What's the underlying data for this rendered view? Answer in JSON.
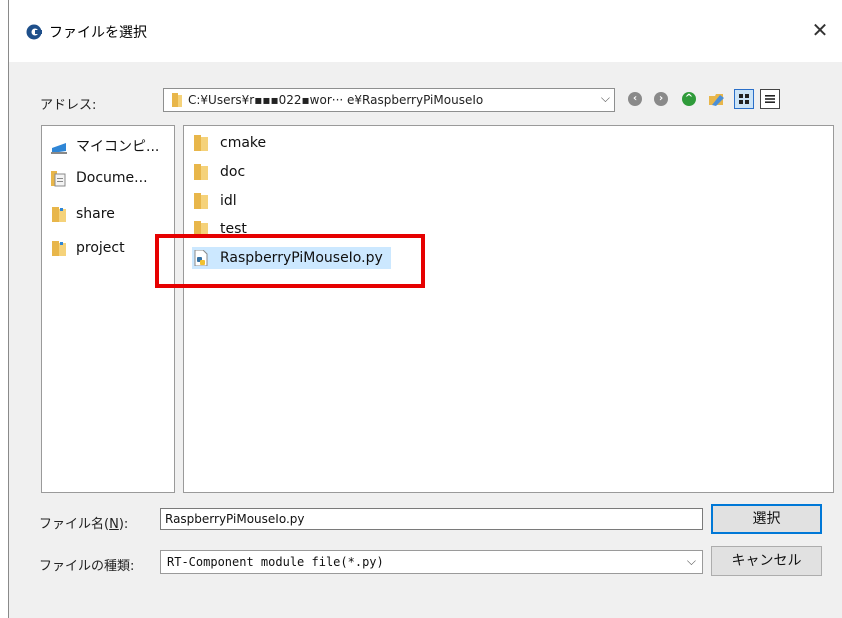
{
  "window": {
    "title": "ファイルを選択",
    "close_symbol": "✕"
  },
  "address": {
    "label": "アドレス:",
    "path": "C:¥Users¥r▪▪▪022▪wor··· e¥RaspberryPiMouseIo",
    "dropdown_symbol": "⌵"
  },
  "toolbar": {
    "back_icon": "arrow-left-icon",
    "forward_icon": "arrow-right-icon",
    "up_icon": "arrow-up-icon",
    "new_folder_icon": "new-folder-icon",
    "view_icons_icon": "view-icons-icon",
    "view_list_icon": "view-list-icon"
  },
  "sidebar": {
    "items": [
      {
        "label": "マイコンピ...",
        "icon": "computer-icon"
      },
      {
        "label": "Docume...",
        "icon": "documents-icon"
      },
      {
        "label": "share",
        "icon": "folder-icon"
      },
      {
        "label": "project",
        "icon": "folder-icon"
      }
    ]
  },
  "files": {
    "items": [
      {
        "label": "cmake",
        "icon": "folder-icon"
      },
      {
        "label": "doc",
        "icon": "folder-icon"
      },
      {
        "label": "idl",
        "icon": "folder-icon"
      },
      {
        "label": "test",
        "icon": "folder-icon"
      },
      {
        "label": "RaspberryPiMouseIo.py",
        "icon": "python-file-icon",
        "selected": true
      }
    ]
  },
  "filename": {
    "label": "ファイル名(N):",
    "label_base": "ファイル名(",
    "label_key": "N",
    "label_end": "):",
    "value": "RaspberryPiMouseIo.py"
  },
  "filetype": {
    "label": "ファイルの種類:",
    "value": "RT-Component module file(*.py)",
    "dropdown_symbol": "⌵"
  },
  "buttons": {
    "select": "選択",
    "cancel": "キャンセル"
  },
  "colors": {
    "highlight": "#e60000",
    "selection": "#cce8ff",
    "primary_border": "#0078d7",
    "folder": "#e8b64a"
  }
}
